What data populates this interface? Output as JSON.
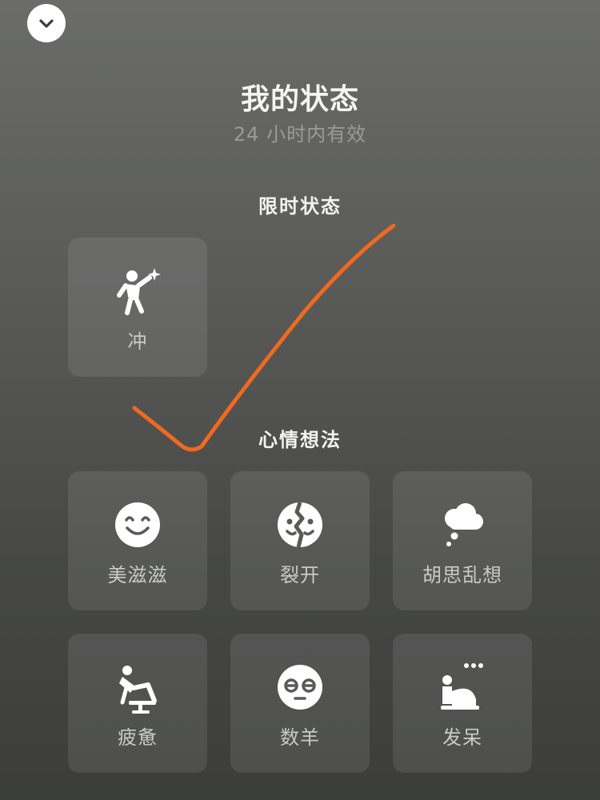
{
  "header": {
    "title": "我的状态",
    "subtitle": "24 小时内有效"
  },
  "sections": {
    "limited": {
      "title": "限时状态",
      "items": [
        {
          "label": "冲",
          "icon": "runner-sparkle-icon"
        }
      ]
    },
    "mood": {
      "title": "心情想法",
      "items": [
        {
          "label": "美滋滋",
          "icon": "smile-face-icon"
        },
        {
          "label": "裂开",
          "icon": "cracked-face-icon"
        },
        {
          "label": "胡思乱想",
          "icon": "thought-cloud-icon"
        },
        {
          "label": "疲惫",
          "icon": "slumped-person-icon"
        },
        {
          "label": "数羊",
          "icon": "sleepy-face-icon"
        },
        {
          "label": "发呆",
          "icon": "daydream-person-icon"
        }
      ]
    }
  },
  "colors": {
    "accent_stroke": "#ef6a1f",
    "tile_bg": "rgba(255,255,255,0.09)",
    "label_text": "#c9cac7"
  }
}
